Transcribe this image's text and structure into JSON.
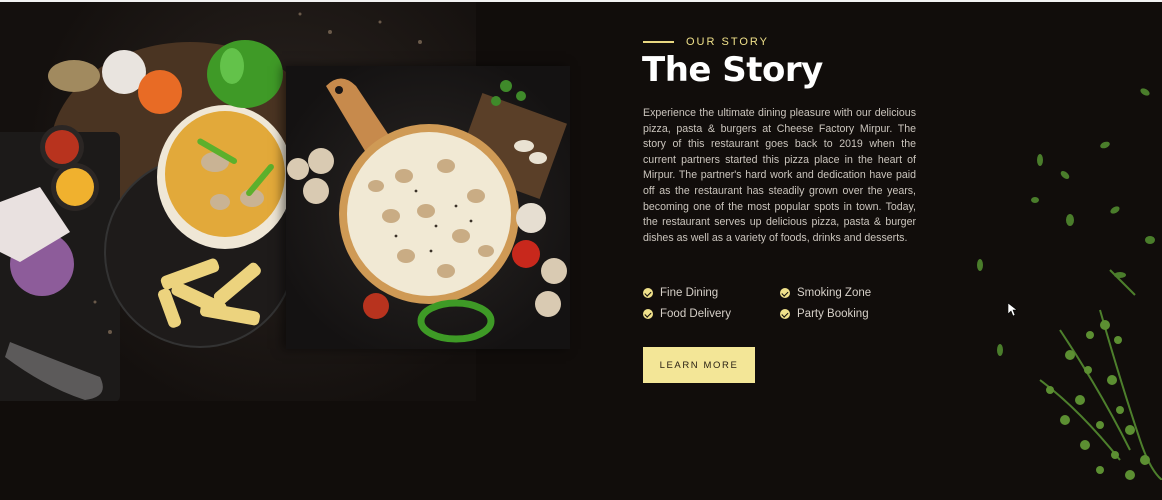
{
  "story": {
    "eyebrow": "OUR STORY",
    "title": "The Story",
    "body": "Experience the ultimate dining pleasure with our delicious pizza, pasta & burgers at Cheese Factory Mirpur. The story of this restaurant goes back to 2019 when the current partners started this pizza place in the heart of Mirpur. The partner's hard work and dedication have paid off as the restaurant has steadily grown over the years, becoming one of the most popular spots in town. Today, the restaurant serves up delicious pizza, pasta & burger dishes as well as a variety of foods, drinks and desserts.",
    "features": [
      "Fine Dining",
      "Smoking Zone",
      "Food Delivery",
      "Party Booking"
    ],
    "button_label": "LEARN MORE"
  },
  "colors": {
    "background": "#110d0b",
    "accent": "#efe08a",
    "button": "#f3e697",
    "title": "#ffffff"
  },
  "icons": [
    "check-circle-icon",
    "mouse-cursor-icon"
  ]
}
